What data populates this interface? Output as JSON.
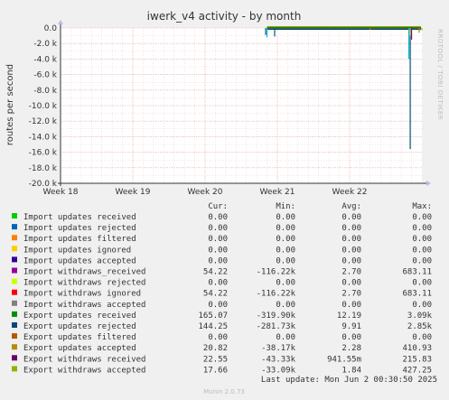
{
  "chart_data": {
    "type": "line",
    "title": "iwerk_v4 activity - by month",
    "ylabel": "routes per second",
    "side_text": "RRDTOOL / TOBI OETIKER",
    "ylim": [
      -20000,
      0
    ],
    "y_ticks": [
      {
        "value": 0,
        "label": "0.0"
      },
      {
        "value": -2000,
        "label": "-2.0 k"
      },
      {
        "value": -4000,
        "label": "-4.0 k"
      },
      {
        "value": -6000,
        "label": "-6.0 k"
      },
      {
        "value": -8000,
        "label": "-8.0 k"
      },
      {
        "value": -10000,
        "label": "-10.0 k"
      },
      {
        "value": -12000,
        "label": "-12.0 k"
      },
      {
        "value": -14000,
        "label": "-14.0 k"
      },
      {
        "value": -16000,
        "label": "-16.0 k"
      },
      {
        "value": -18000,
        "label": "-18.0 k"
      },
      {
        "value": -20000,
        "label": "-20.0 k"
      }
    ],
    "xlim": [
      "2025-04-28",
      "2025-06-02"
    ],
    "x_ticks": [
      {
        "date": "2025-04-28",
        "label": "Week 18"
      },
      {
        "date": "2025-05-05",
        "label": "Week 19"
      },
      {
        "date": "2025-05-12",
        "label": "Week 20"
      },
      {
        "date": "2025-05-19",
        "label": "Week 21"
      },
      {
        "date": "2025-05-26",
        "label": "Week 22"
      }
    ],
    "data_start": "2025-05-18",
    "spikes": [
      {
        "date": "2025-05-18",
        "value": -1200,
        "color": "#00bbcc"
      },
      {
        "date": "2025-05-18",
        "value": -900,
        "color": "#005577"
      },
      {
        "date": "2025-05-19",
        "value": -1100,
        "color": "#005577"
      },
      {
        "date": "2025-05-28",
        "value": -200,
        "color": "#cc7700"
      },
      {
        "date": "2025-06-01",
        "value": -15600,
        "color": "#005577"
      },
      {
        "date": "2025-06-01",
        "value": -4000,
        "color": "#00bbcc"
      },
      {
        "date": "2025-06-01",
        "value": -1500,
        "color": "#880088"
      },
      {
        "date": "2025-06-01",
        "value": -1000,
        "color": "#99bb00"
      },
      {
        "date": "2025-06-02",
        "value": -600,
        "color": "#cc7700"
      },
      {
        "date": "2025-06-02",
        "value": -300,
        "color": "#99bb00"
      }
    ],
    "columns": [
      "Cur:",
      "Min:",
      "Avg:",
      "Max:"
    ],
    "series": [
      {
        "name": "Import updates received",
        "color": "#00cc00",
        "cur": "0.00",
        "min": "0.00",
        "avg": "0.00",
        "max": "0.00"
      },
      {
        "name": "Import updates rejected",
        "color": "#0066b3",
        "cur": "0.00",
        "min": "0.00",
        "avg": "0.00",
        "max": "0.00"
      },
      {
        "name": "Import updates filtered",
        "color": "#ff8000",
        "cur": "0.00",
        "min": "0.00",
        "avg": "0.00",
        "max": "0.00"
      },
      {
        "name": "Import updates ignored",
        "color": "#ffcc00",
        "cur": "0.00",
        "min": "0.00",
        "avg": "0.00",
        "max": "0.00"
      },
      {
        "name": "Import updates accepted",
        "color": "#330099",
        "cur": "0.00",
        "min": "0.00",
        "avg": "0.00",
        "max": "0.00"
      },
      {
        "name": "Import withdraws_received",
        "color": "#990099",
        "cur": "54.22",
        "min": "-116.22k",
        "avg": "2.70",
        "max": "683.11"
      },
      {
        "name": "Import withdraws rejected",
        "color": "#ccff00",
        "cur": "0.00",
        "min": "0.00",
        "avg": "0.00",
        "max": "0.00"
      },
      {
        "name": "Import withdraws ignored",
        "color": "#ff0000",
        "cur": "54.22",
        "min": "-116.22k",
        "avg": "2.70",
        "max": "683.11"
      },
      {
        "name": "Import withdraws accepted",
        "color": "#808080",
        "cur": "0.00",
        "min": "0.00",
        "avg": "0.00",
        "max": "0.00"
      },
      {
        "name": "Export updates received",
        "color": "#008f00",
        "cur": "165.07",
        "min": "-319.90k",
        "avg": "12.19",
        "max": "3.09k"
      },
      {
        "name": "Export updates rejected",
        "color": "#00487d",
        "cur": "144.25",
        "min": "-281.73k",
        "avg": "9.91",
        "max": "2.85k"
      },
      {
        "name": "Export updates filtered",
        "color": "#b35a00",
        "cur": "0.00",
        "min": "0.00",
        "avg": "0.00",
        "max": "0.00"
      },
      {
        "name": "Export updates accepted",
        "color": "#b38f00",
        "cur": "20.82",
        "min": "-38.17k",
        "avg": "2.28",
        "max": "410.93"
      },
      {
        "name": "Export withdraws received",
        "color": "#6b006b",
        "cur": "22.55",
        "min": "-43.33k",
        "avg": "941.55m",
        "max": "215.83"
      },
      {
        "name": "Export withdraws accepted",
        "color": "#8fb300",
        "cur": "17.66",
        "min": "-33.09k",
        "avg": "1.84",
        "max": "427.25"
      }
    ],
    "last_update": "Last update: Mon Jun  2 00:30:50 2025",
    "footer": "Munin 2.0.73"
  }
}
